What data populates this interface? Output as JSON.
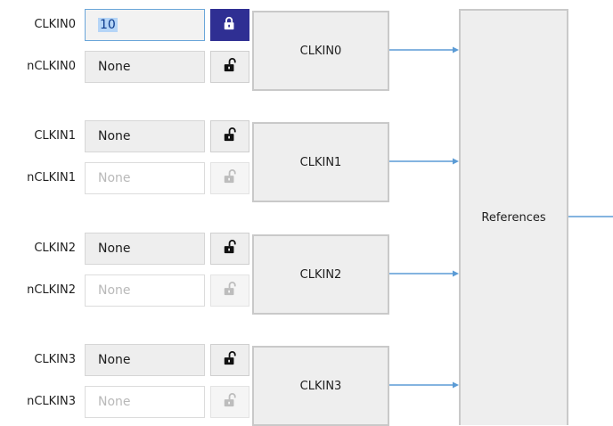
{
  "reference_block": {
    "label": "References"
  },
  "groups": [
    {
      "clkin": {
        "label": "CLKIN0",
        "value": "10",
        "locked": true,
        "state": "active"
      },
      "nclkin": {
        "label": "nCLKIN0",
        "value": "None",
        "locked": false,
        "state": "normal"
      },
      "block_label": "CLKIN0"
    },
    {
      "clkin": {
        "label": "CLKIN1",
        "value": "None",
        "locked": false,
        "state": "normal"
      },
      "nclkin": {
        "label": "nCLKIN1",
        "value": "None",
        "locked": false,
        "state": "disabled"
      },
      "block_label": "CLKIN1"
    },
    {
      "clkin": {
        "label": "CLKIN2",
        "value": "None",
        "locked": false,
        "state": "normal"
      },
      "nclkin": {
        "label": "nCLKIN2",
        "value": "None",
        "locked": false,
        "state": "disabled"
      },
      "block_label": "CLKIN2"
    },
    {
      "clkin": {
        "label": "CLKIN3",
        "value": "None",
        "locked": false,
        "state": "normal"
      },
      "nclkin": {
        "label": "nCLKIN3",
        "value": "None",
        "locked": false,
        "state": "disabled"
      },
      "block_label": "CLKIN3"
    }
  ],
  "icons": {
    "locked": "lock-closed-icon",
    "unlocked": "lock-open-icon"
  },
  "colors": {
    "connector": "#5b9bd5",
    "lock_active_bg": "#2f2f93",
    "selection": "#b5d5f7",
    "block_bg": "#eeeeee",
    "block_border": "#c9c9c9"
  }
}
